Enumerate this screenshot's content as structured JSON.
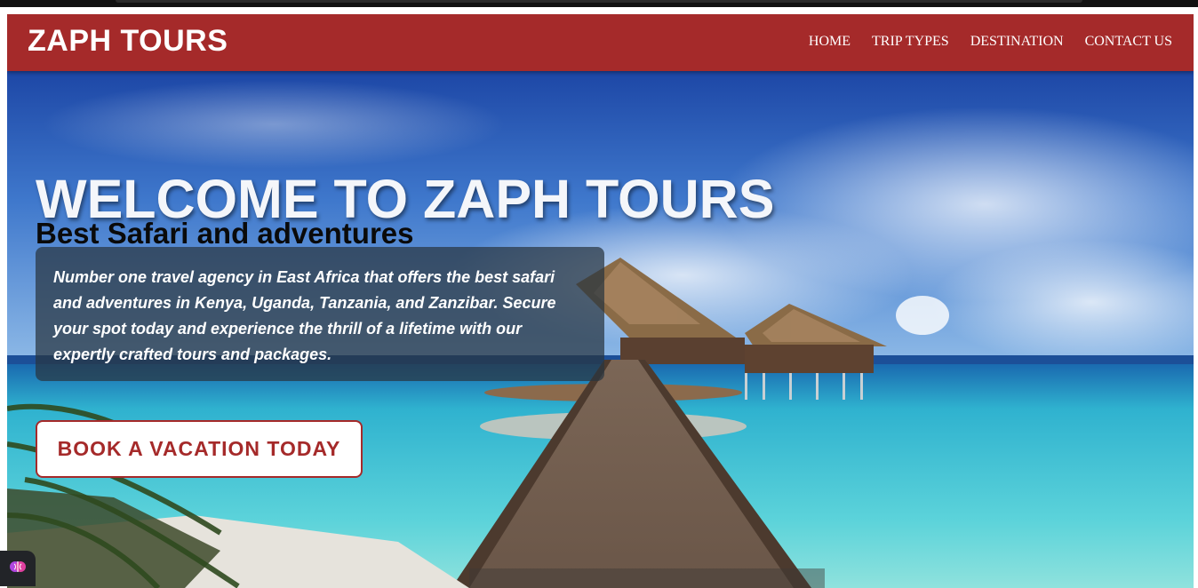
{
  "navbar": {
    "brand": "ZAPH TOURS",
    "links": [
      {
        "label": "HOME"
      },
      {
        "label": "TRIP TYPES"
      },
      {
        "label": "DESTINATION"
      },
      {
        "label": "CONTACT US"
      }
    ]
  },
  "hero": {
    "title": "WELCOME TO ZAPH TOURS",
    "subtitle": "Best Safari and adventures",
    "description": "Number one travel agency in East Africa that offers the best safari and adventures in Kenya, Uganda, Tanzania, and Zanzibar. Secure your spot today and experience the thrill of a lifetime with our expertly crafted tours and packages.",
    "cta_label": "BOOK A VACATION TODAY"
  },
  "colors": {
    "brand": "#a52a2a",
    "white": "#ffffff"
  },
  "icons": {
    "widget": "brain-icon"
  }
}
